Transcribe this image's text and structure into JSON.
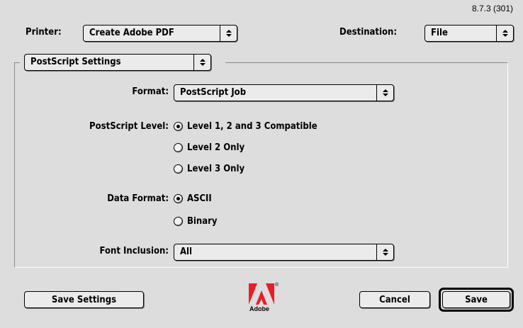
{
  "version": "8.7.3 (301)",
  "header": {
    "printer_label": "Printer:",
    "printer_value": "Create Adobe PDF",
    "destination_label": "Destination:",
    "destination_value": "File"
  },
  "panel_menu": {
    "value": "PostScript Settings"
  },
  "settings": {
    "format_label": "Format:",
    "format_value": "PostScript Job",
    "level_label": "PostScript Level:",
    "level_options": [
      {
        "label": "Level 1, 2 and 3 Compatible",
        "selected": true
      },
      {
        "label": "Level 2 Only",
        "selected": false
      },
      {
        "label": "Level 3 Only",
        "selected": false
      }
    ],
    "data_format_label": "Data Format:",
    "data_format_options": [
      {
        "label": "ASCII",
        "selected": true
      },
      {
        "label": "Binary",
        "selected": false
      }
    ],
    "font_inclusion_label": "Font Inclusion:",
    "font_inclusion_value": "All"
  },
  "footer": {
    "save_settings_label": "Save Settings",
    "cancel_label": "Cancel",
    "save_label": "Save",
    "logo_text": "Adobe",
    "logo_reg": "®"
  },
  "colors": {
    "background": "#dddddd",
    "button_face": "#ebebeb",
    "logo_red": "#ed1c24"
  }
}
